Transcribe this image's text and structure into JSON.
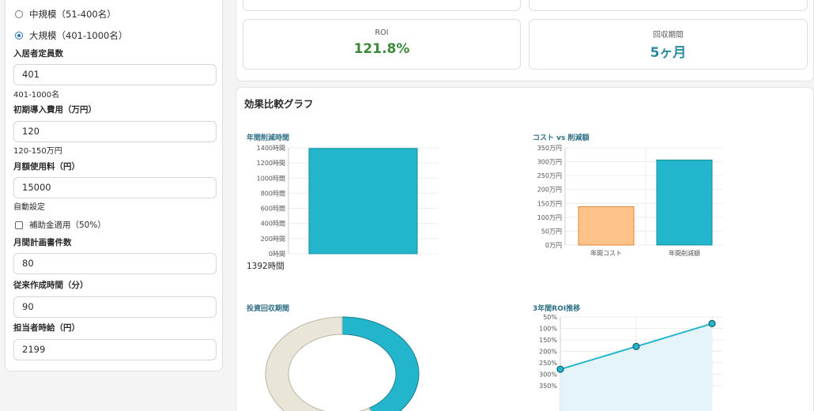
{
  "form": {
    "size_medium_label": "中規模（51-400名）",
    "size_large_label": "大規模（401-1000名）",
    "capacity": {
      "label": "入居者定員数",
      "value": "401",
      "hint": "401-1000名"
    },
    "initial_cost": {
      "label": "初期導入費用（万円）",
      "value": "120",
      "hint": "120-150万円"
    },
    "monthly_fee": {
      "label": "月額使用料（円）",
      "value": "15000",
      "hint": "自動設定"
    },
    "subsidy_label": "補助金適用（50%）",
    "monthly_plans": {
      "label": "月間計画書件数",
      "value": "80"
    },
    "prev_time": {
      "label": "従来作成時間（分）",
      "value": "90"
    },
    "hourly_wage": {
      "label": "担当者時給（円）",
      "value": "2199"
    }
  },
  "summary": {
    "roi_label": "ROI",
    "roi_value": "121.8%",
    "payback_label": "回収期間",
    "payback_value": "5ヶ月"
  },
  "colors": {
    "teal": "#22b5cc",
    "orange": "#ffc389",
    "beige": "#e9e6d9",
    "green": "#3a8a3a",
    "teal_text": "#2b8aa0"
  },
  "charts": {
    "section_title": "効果比較グラフ",
    "hours_total": "1392時間",
    "payback_title": "投資回収期間"
  },
  "chart_data": [
    {
      "type": "bar",
      "title": "年間削減時間",
      "categories": [
        ""
      ],
      "values": [
        1392
      ],
      "ylim": [
        0,
        1400
      ],
      "yticks": [
        "0時間",
        "200時間",
        "400時間",
        "600時間",
        "800時間",
        "1000時間",
        "1200時間",
        "1400時間"
      ],
      "grid": true
    },
    {
      "type": "bar",
      "title": "コスト vs 削減額",
      "categories": [
        "年間コスト",
        "年間削減額"
      ],
      "values": [
        138,
        306
      ],
      "ylim": [
        0,
        350
      ],
      "yticks": [
        "0万円",
        "50万円",
        "100万円",
        "150万円",
        "200万円",
        "250万円",
        "300万円",
        "350万円"
      ],
      "grid": true
    },
    {
      "type": "pie",
      "title": "投資回収期間",
      "values": [
        5,
        7
      ],
      "donut": true
    },
    {
      "type": "line",
      "title": "3年間ROI推移",
      "x": [
        1,
        2,
        3
      ],
      "values": [
        121.8,
        221,
        321
      ],
      "ylim": [
        0,
        350
      ],
      "yticks_visible": [
        "50%",
        "100%",
        "150%",
        "200%",
        "250%",
        "300%",
        "350%"
      ],
      "grid": true
    }
  ]
}
